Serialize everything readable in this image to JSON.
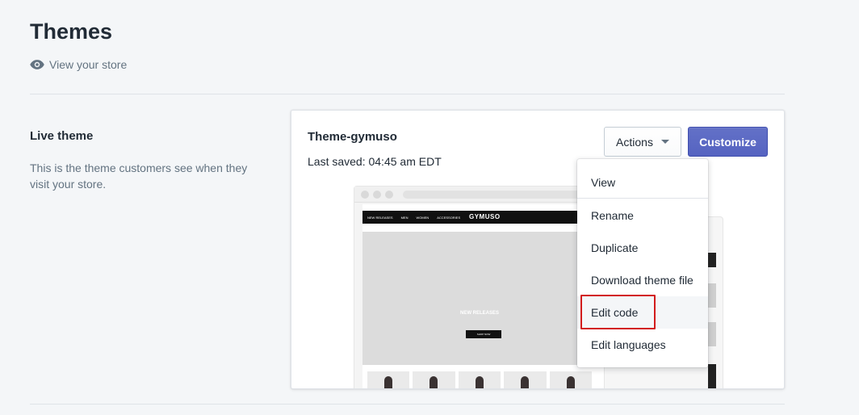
{
  "header": {
    "title": "Themes",
    "view_store_label": "View your store"
  },
  "live_theme": {
    "heading": "Live theme",
    "description": "This is the theme customers see when they visit your store."
  },
  "theme_card": {
    "name": "Theme-gymuso",
    "last_saved": "Last saved: 04:45 am EDT",
    "actions_label": "Actions",
    "customize_label": "Customize",
    "preview": {
      "logo": "GYMUSO",
      "hero_title": "NEW RELEASES",
      "hero_button": "SHOP NOW",
      "nav_items": [
        "NEW RELEASES",
        "MEN",
        "WOMEN",
        "ACCESSORIES"
      ]
    }
  },
  "actions_menu": {
    "items": [
      {
        "label": "View"
      },
      {
        "label": "Rename"
      },
      {
        "label": "Duplicate"
      },
      {
        "label": "Download theme file"
      },
      {
        "label": "Edit code"
      },
      {
        "label": "Edit languages"
      }
    ]
  },
  "colors": {
    "primary_button": "#5c6ac4",
    "highlight_box": "#d21c1c",
    "background": "#f4f6f8"
  },
  "icons": {
    "view_store": "eye-icon",
    "actions_caret": "caret-down-icon"
  }
}
